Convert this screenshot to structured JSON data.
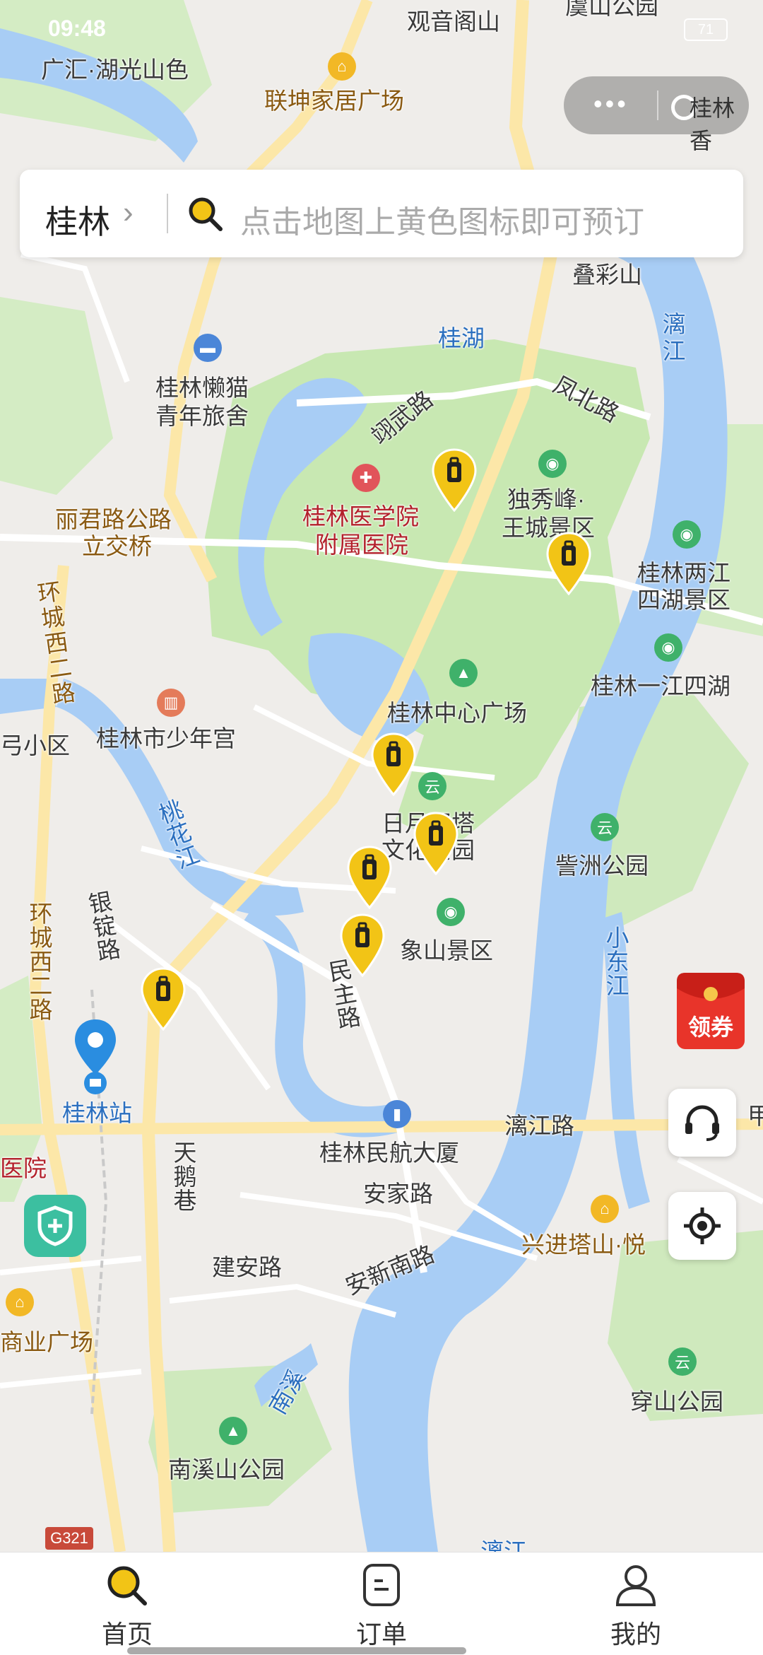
{
  "status_bar": {
    "time": "09:48",
    "battery": "71"
  },
  "capsule": {
    "label": "桂林香"
  },
  "search": {
    "city": "桂林",
    "placeholder": "点击地图上黄色图标即可预订"
  },
  "map": {
    "labels": {
      "guanyinge": "观音阁山",
      "yushan": "虞山公园",
      "guanghui": "广汇·湖光山色",
      "liankun": "联坤家居广场",
      "diecaishan": "叠彩山",
      "guihu": "桂湖",
      "lijiang": "漓江",
      "lanmao_1": "桂林懒猫",
      "lanmao_2": "青年旅舍",
      "yingwu": "翊武路",
      "fengbei": "凤北路",
      "duxiu_1": "独秀峰·",
      "duxiu_2": "王城景区",
      "yixue_1": "桂林医学院",
      "yixue_2": "附属医院",
      "lijun_1": "丽君路公路",
      "lijun_2": "立交桥",
      "huancheng_1": "环城西二路",
      "liangjiang_1": "桂林两江",
      "liangjiang_2": "四湖景区",
      "yijiang": "桂林一江四湖",
      "xiaoqu": "弓小区",
      "shaonian": "桂林市少年宫",
      "zhongxin": "桂林中心广场",
      "taohuajiang": "桃花江",
      "riyue_1": "日月双塔",
      "riyue_2": "文化公园",
      "zizhou": "訾洲公园",
      "yinding": "银锭路",
      "xiangshan": "象山景区",
      "xiaodongjiang": "小东江",
      "minzhu": "民主路",
      "huancheng_2": "环城西二路",
      "station": "桂林站",
      "lijiang_road": "漓江路",
      "minhang": "桂林民航大厦",
      "yiyuan": "医院",
      "tiane": "天鹅巷",
      "anjia": "安家路",
      "anxin": "安新南路",
      "xingjin": "兴进塔山·悦",
      "jianan": "建安路",
      "shangye": "商业广场",
      "nanxi": "南溪",
      "chuanshan": "穿山公园",
      "nanxishan": "南溪山公园",
      "road_code": "G321",
      "lijiang_bottom": "漓江",
      "edge_right": "甲"
    },
    "pin_count": 7
  },
  "floating": {
    "coupon": "领券"
  },
  "tabs": [
    {
      "label": "首页",
      "icon": "search-icon"
    },
    {
      "label": "订单",
      "icon": "order-icon"
    },
    {
      "label": "我的",
      "icon": "profile-icon"
    }
  ],
  "colors": {
    "pin": "#f2c416",
    "accent": "#f0c000",
    "water": "#a8cdf5",
    "park": "#c6e8b0",
    "station_pin": "#2a8de0"
  }
}
